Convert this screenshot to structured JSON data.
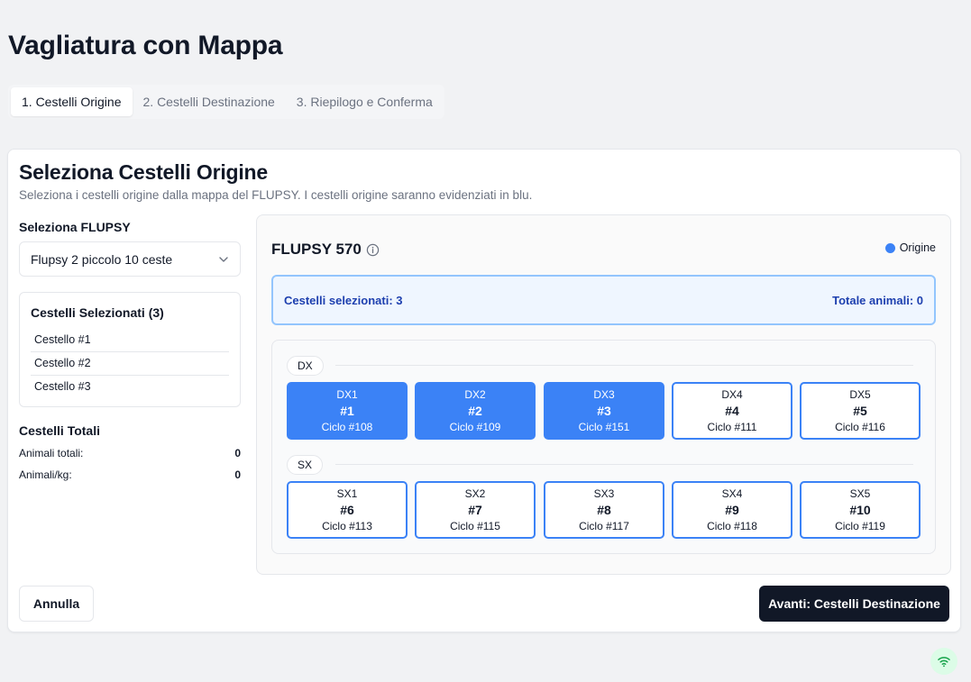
{
  "page": {
    "title": "Vagliatura con Mappa"
  },
  "tabs": [
    {
      "label": "1. Cestelli Origine",
      "active": true
    },
    {
      "label": "2. Cestelli Destinazione",
      "active": false
    },
    {
      "label": "3. Riepilogo e Conferma",
      "active": false
    }
  ],
  "card": {
    "title": "Seleziona Cestelli Origine",
    "description": "Seleziona i cestelli origine dalla mappa del FLUPSY. I cestelli origine saranno evidenziati in blu."
  },
  "left": {
    "flupsy_label": "Seleziona FLUPSY",
    "flupsy_selected": "Flupsy 2 piccolo 10 ceste",
    "selected_title": "Cestelli Selezionati (3)",
    "selected_items": [
      "Cestello #1",
      "Cestello #2",
      "Cestello #3"
    ],
    "totals_title": "Cestelli Totali",
    "animals_label": "Animali totali:",
    "animals_value": "0",
    "per_kg_label": "Animali/kg:",
    "per_kg_value": "0"
  },
  "map": {
    "flupsy_name": "FLUPSY 570",
    "legend_label": "Origine",
    "summary_selected": "Cestelli selezionati: 3",
    "summary_total": "Totale animali: 0",
    "rows": [
      {
        "label": "DX",
        "baskets": [
          {
            "pos": "DX1",
            "num": "#1",
            "cycle": "Ciclo #108",
            "selected": true
          },
          {
            "pos": "DX2",
            "num": "#2",
            "cycle": "Ciclo #109",
            "selected": true
          },
          {
            "pos": "DX3",
            "num": "#3",
            "cycle": "Ciclo #151",
            "selected": true
          },
          {
            "pos": "DX4",
            "num": "#4",
            "cycle": "Ciclo #111",
            "selected": false
          },
          {
            "pos": "DX5",
            "num": "#5",
            "cycle": "Ciclo #116",
            "selected": false
          }
        ]
      },
      {
        "label": "SX",
        "baskets": [
          {
            "pos": "SX1",
            "num": "#6",
            "cycle": "Ciclo #113",
            "selected": false
          },
          {
            "pos": "SX2",
            "num": "#7",
            "cycle": "Ciclo #115",
            "selected": false
          },
          {
            "pos": "SX3",
            "num": "#8",
            "cycle": "Ciclo #117",
            "selected": false
          },
          {
            "pos": "SX4",
            "num": "#9",
            "cycle": "Ciclo #118",
            "selected": false
          },
          {
            "pos": "SX5",
            "num": "#10",
            "cycle": "Ciclo #119",
            "selected": false
          }
        ]
      }
    ]
  },
  "actions": {
    "cancel_label": "Annulla",
    "next_label": "Avanti: Cestelli Destinazione"
  },
  "colors": {
    "accent": "#3b82f6",
    "summary_text": "#1e40af",
    "primary_button": "#111827",
    "status_online": "#16a34a"
  }
}
